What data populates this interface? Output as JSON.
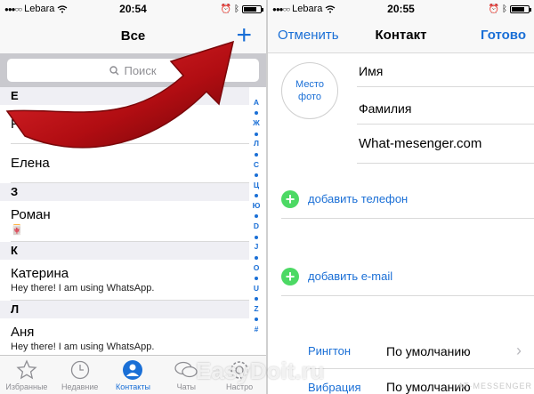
{
  "left": {
    "status": {
      "carrier": "Lebara",
      "time": "20:54",
      "battery_level": 0.8
    },
    "nav": {
      "title": "Все",
      "add_icon": "plus-icon"
    },
    "search": {
      "placeholder": "Поиск"
    },
    "sections": [
      {
        "letter": "Е",
        "rows": [
          {
            "name": "Рит"
          },
          {
            "name": "Елена"
          }
        ]
      },
      {
        "letter": "З",
        "rows": [
          {
            "name": "Роман",
            "sub": "🀄"
          }
        ]
      },
      {
        "letter": "К",
        "rows": [
          {
            "name": "Катерина",
            "sub": "Hey there! I am using WhatsApp."
          }
        ]
      },
      {
        "letter": "Л",
        "rows": [
          {
            "name": "Аня",
            "sub": "Hey there! I am using WhatsApp."
          }
        ]
      }
    ],
    "index": [
      "А",
      "Ж",
      "Л",
      "С",
      "Ц",
      "Ю",
      "D",
      "J",
      "O",
      "U",
      "Z",
      "#"
    ],
    "tabs": [
      {
        "label": "Избранные",
        "icon": "star-icon"
      },
      {
        "label": "Недавние",
        "icon": "clock-icon"
      },
      {
        "label": "Контакты",
        "icon": "person-icon",
        "active": true
      },
      {
        "label": "Чаты",
        "icon": "chat-bubbles-icon"
      },
      {
        "label": "Настро",
        "icon": "settings-gear-icon"
      }
    ],
    "colors": {
      "accent": "#1a6fd6",
      "arrow": "#b10d12"
    }
  },
  "right": {
    "status": {
      "carrier": "Lebara",
      "time": "20:55",
      "battery_level": 0.8
    },
    "nav": {
      "cancel": "Отменить",
      "title": "Контакт",
      "done": "Готово"
    },
    "photo_label_1": "Место",
    "photo_label_2": "фото",
    "fields": {
      "first": "Имя",
      "last": "Фамилия",
      "company": "What-mesenger.com"
    },
    "add_phone": "добавить телефон",
    "add_email": "добавить e-mail",
    "ringtone": {
      "label": "Рингтон",
      "value": "По умолчанию"
    },
    "vibration": {
      "label": "Вибрация",
      "value": "По умолчанию"
    },
    "colors": {
      "add": "#4cd964"
    }
  },
  "watermarks": {
    "main": "EasyDoit.ru",
    "corner": "AT·MESSENGER"
  }
}
